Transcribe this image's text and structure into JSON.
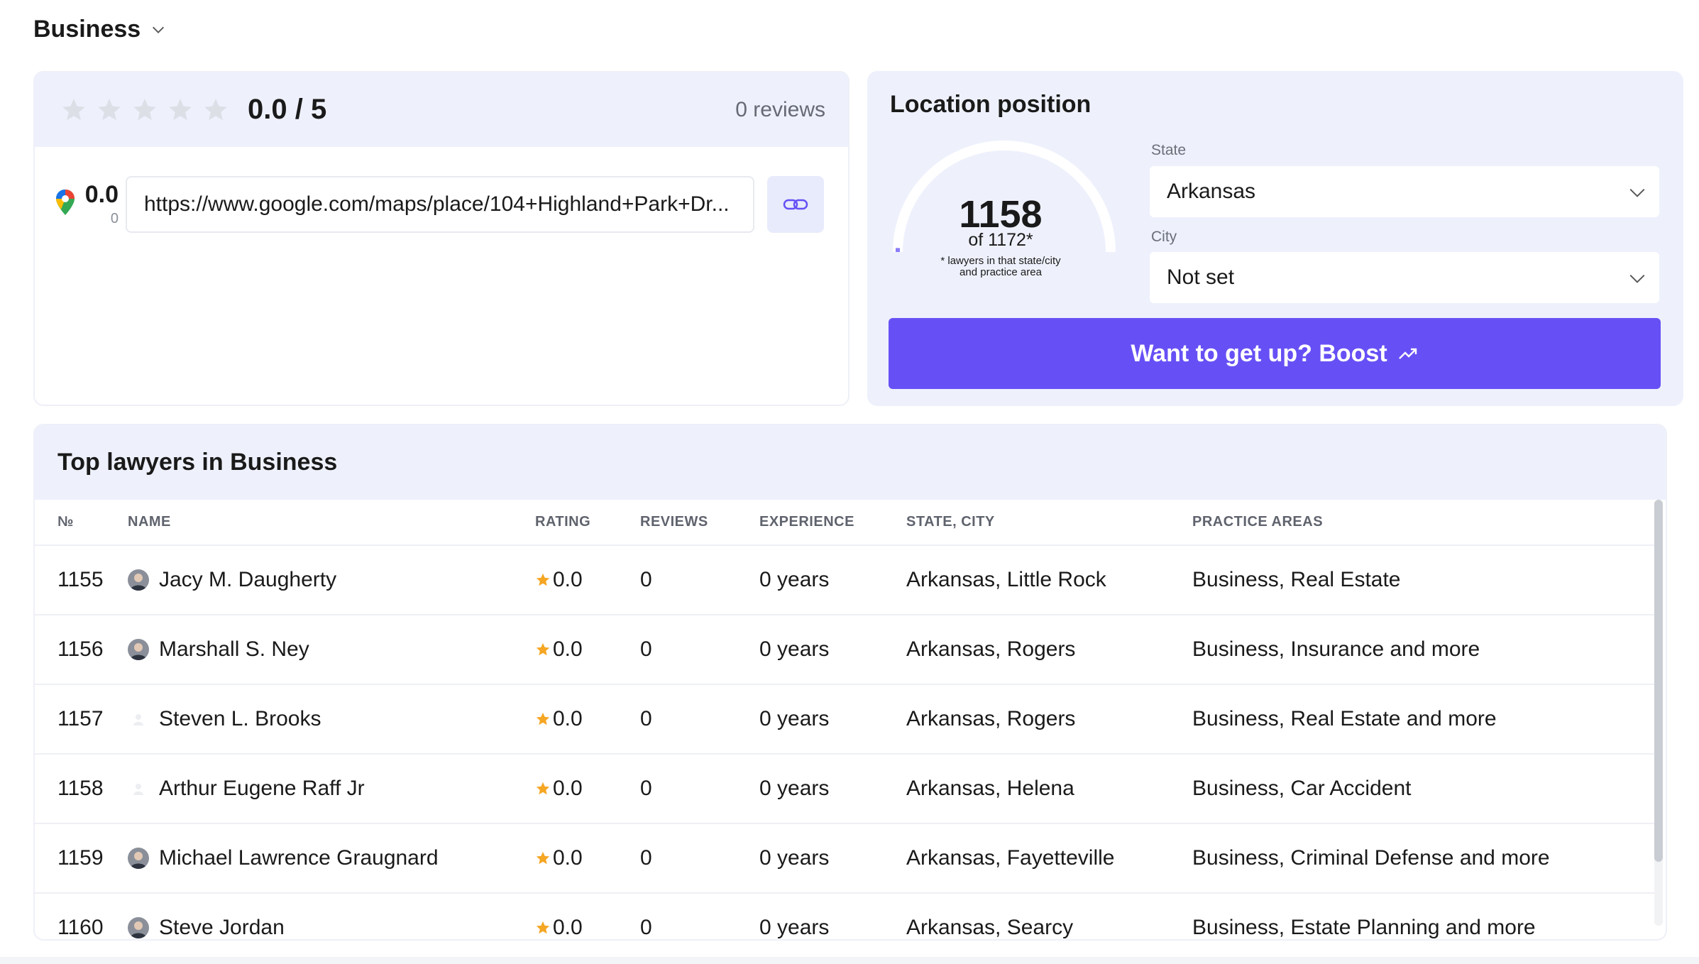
{
  "header": {
    "title": "Business"
  },
  "rating": {
    "score_label": "0.0 / 5",
    "reviews_label": "0 reviews",
    "google_score": "0.0",
    "google_count": "0",
    "place_url": "https://www.google.com/maps/place/104+Highland+Park+Dr...",
    "star_rating": 0,
    "star_color": "#dcdfe6"
  },
  "location": {
    "title": "Location position",
    "position": "1158",
    "of_label": "of 1172*",
    "note_line1": "* lawyers in that state/city",
    "note_line2": "and practice area",
    "position_fraction": 0.012,
    "state_label": "State",
    "state_value": "Arkansas",
    "city_label": "City",
    "city_value": "Not set",
    "boost_label": "Want to get up? Boost",
    "accent_color": "#6650f5"
  },
  "table": {
    "title": "Top lawyers in Business",
    "columns": [
      "№",
      "NAME",
      "RATING",
      "REVIEWS",
      "EXPERIENCE",
      "STATE, CITY",
      "PRACTICE AREAS"
    ],
    "rows": [
      {
        "rank": "1155",
        "name": "Jacy M. Daugherty",
        "rating": "0.0",
        "reviews": "0",
        "experience": "0 years",
        "location": "Arkansas, Little Rock",
        "practice": "Business, Real Estate",
        "avatar": "photo"
      },
      {
        "rank": "1156",
        "name": "Marshall S. Ney",
        "rating": "0.0",
        "reviews": "0",
        "experience": "0 years",
        "location": "Arkansas, Rogers",
        "practice": "Business, Insurance and more",
        "avatar": "photo"
      },
      {
        "rank": "1157",
        "name": "Steven L. Brooks",
        "rating": "0.0",
        "reviews": "0",
        "experience": "0 years",
        "location": "Arkansas, Rogers",
        "practice": "Business, Real Estate and more",
        "avatar": "placeholder"
      },
      {
        "rank": "1158",
        "name": "Arthur Eugene Raff Jr",
        "rating": "0.0",
        "reviews": "0",
        "experience": "0 years",
        "location": "Arkansas, Helena",
        "practice": "Business, Car Accident",
        "avatar": "placeholder"
      },
      {
        "rank": "1159",
        "name": "Michael Lawrence Graugnard",
        "rating": "0.0",
        "reviews": "0",
        "experience": "0 years",
        "location": "Arkansas, Fayetteville",
        "practice": "Business, Criminal Defense and more",
        "avatar": "photo"
      },
      {
        "rank": "1160",
        "name": "Steve Jordan",
        "rating": "0.0",
        "reviews": "0",
        "experience": "0 years",
        "location": "Arkansas, Searcy",
        "practice": "Business, Estate Planning and more",
        "avatar": "photo"
      }
    ],
    "rating_star_color": "#f5a623"
  }
}
